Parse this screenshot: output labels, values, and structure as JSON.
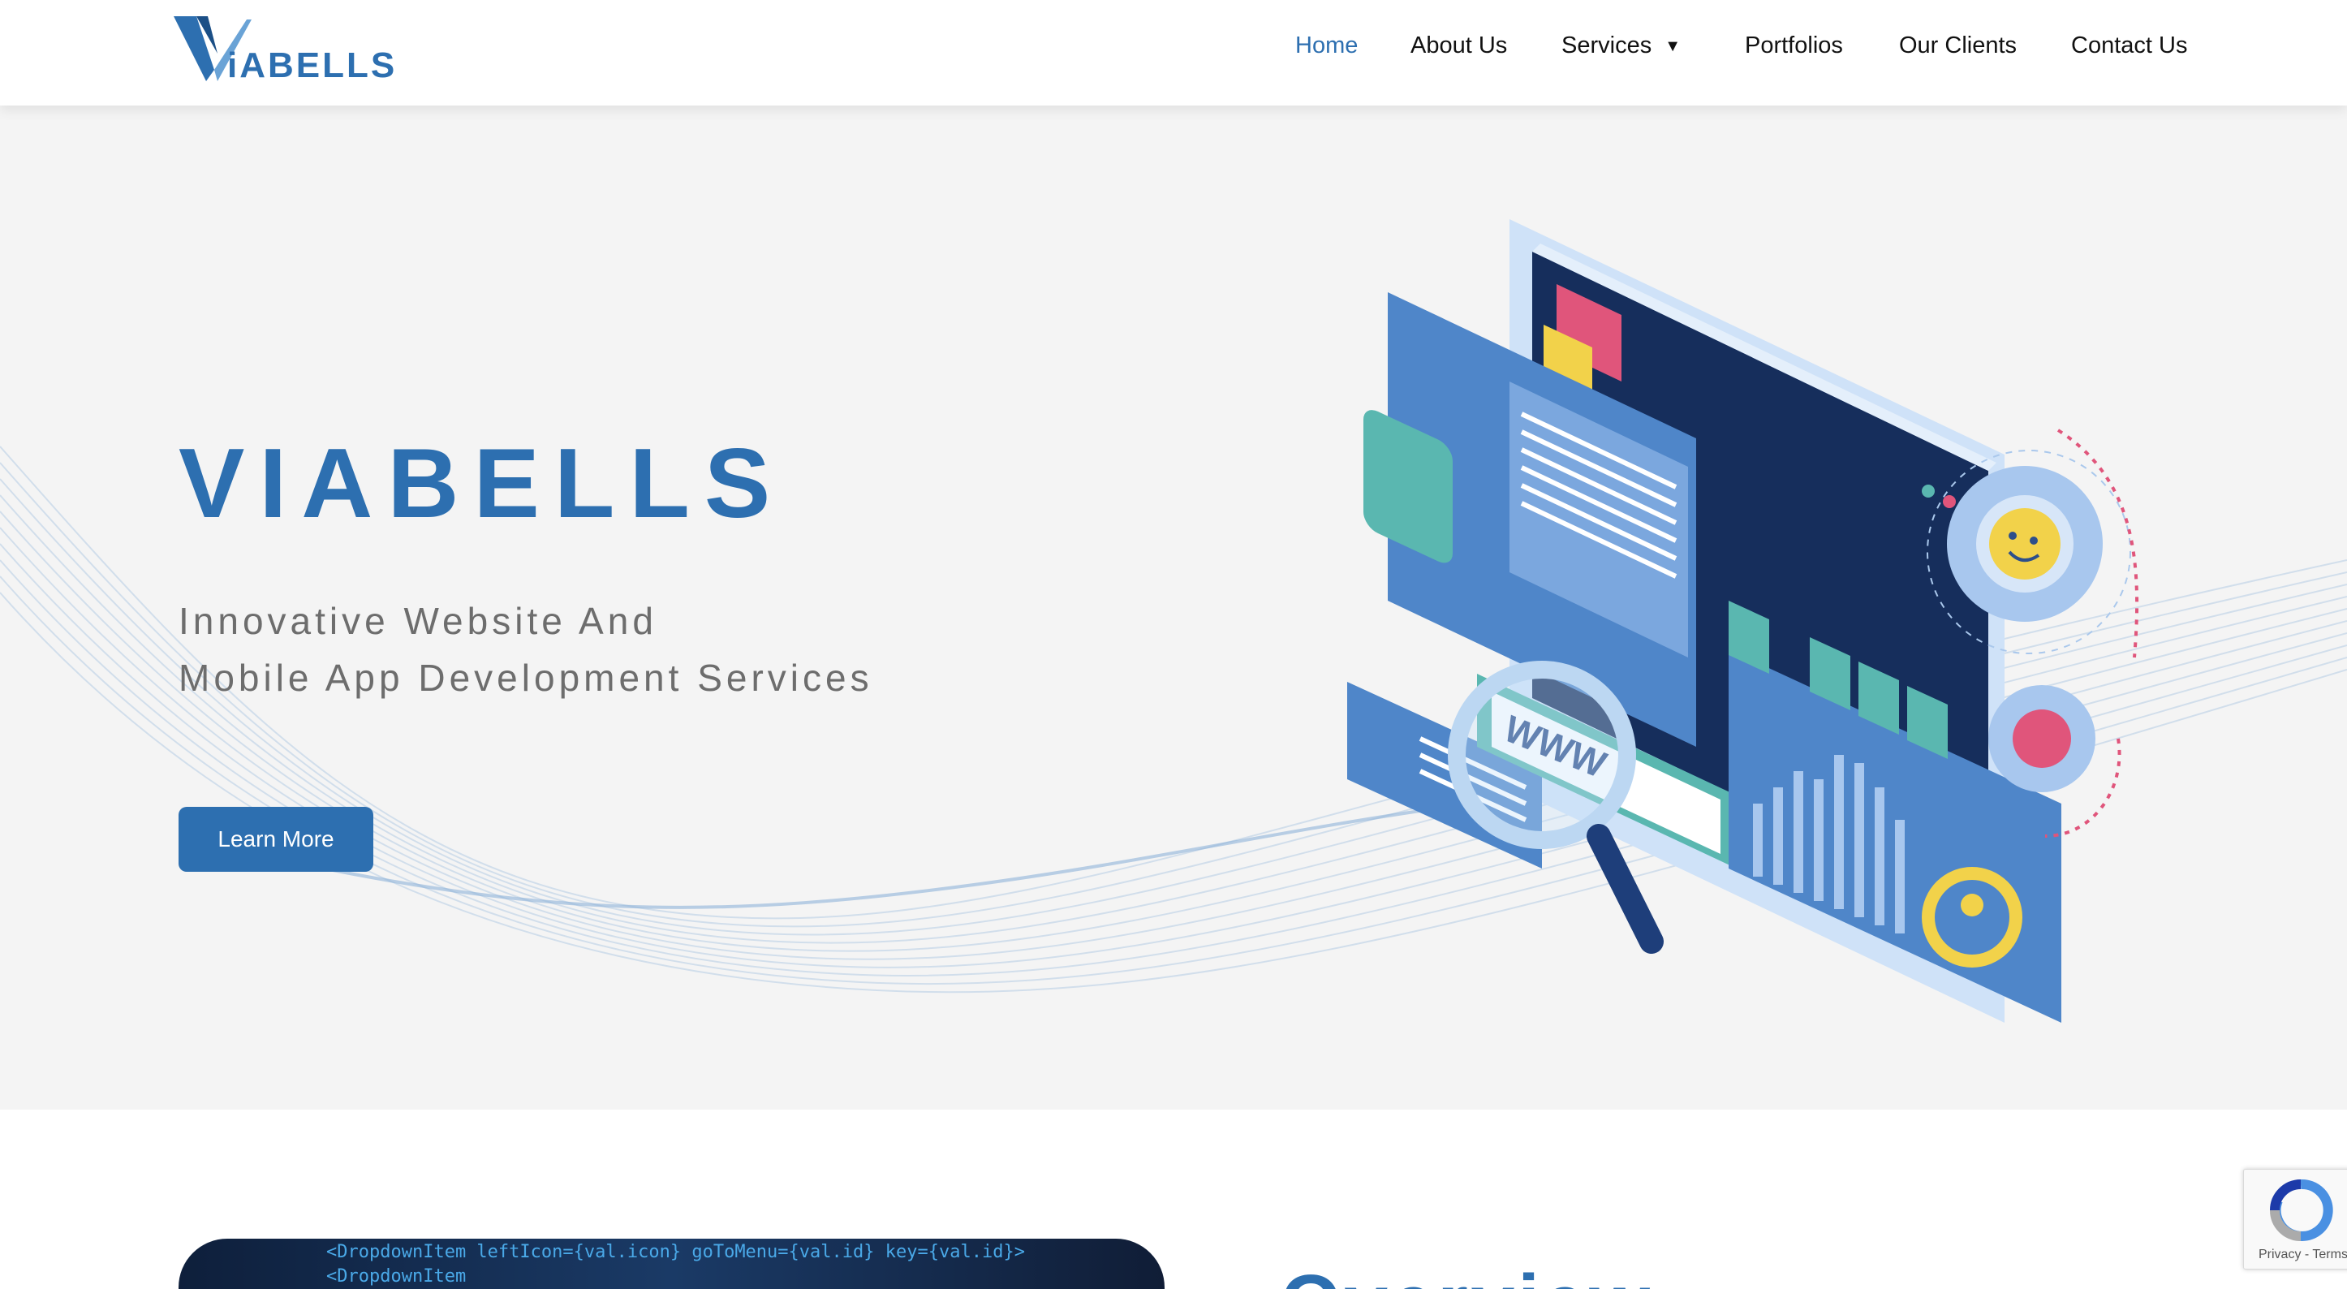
{
  "header": {
    "logo_text": "iABELLS",
    "nav": [
      {
        "label": "Home",
        "active": true
      },
      {
        "label": "About Us"
      },
      {
        "label": "Services",
        "has_dropdown": true
      },
      {
        "label": "Portfolios"
      },
      {
        "label": "Our Clients"
      },
      {
        "label": "Contact Us"
      }
    ]
  },
  "hero": {
    "title": "VIABELLS",
    "subtitle_line1": "Innovative Website And",
    "subtitle_line2": "Mobile App Development Services",
    "cta_label": "Learn More",
    "illustration_text": "WWW"
  },
  "overview": {
    "title": "Overview",
    "code_line1": "<DropdownItem leftIcon={val.icon} goToMenu={val.id} key={val.id}>",
    "code_line2": "<DropdownItem"
  },
  "recaptcha": {
    "links": "Privacy - Terms"
  },
  "colors": {
    "brand": "#2d6fb0",
    "hero_bg": "#f4f4f4",
    "nav_text": "#111111"
  }
}
